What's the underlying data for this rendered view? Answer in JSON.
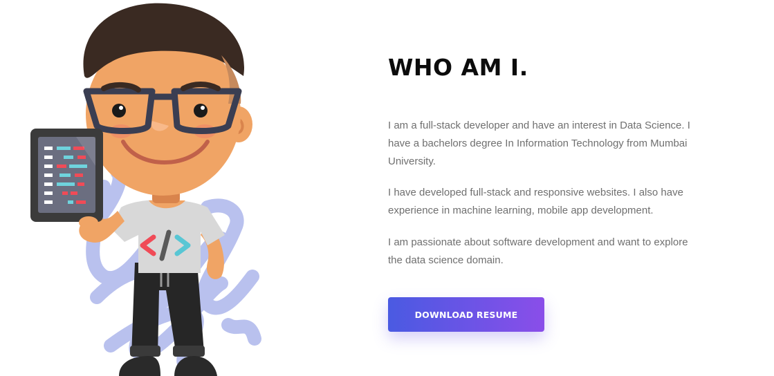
{
  "about": {
    "title": "WHO AM I.",
    "paragraphs": [
      "I am a full-stack developer and have an interest in Data Science. I have a bachelors degree In Information Technology from Mumbai University.",
      "I have developed full-stack and responsive websites. I also have experience in machine learning, mobile app development.",
      "I am passionate about software development and want to explore the data science domain."
    ],
    "download_button_label": "DOWNLOAD RESUME"
  },
  "illustration": {
    "subject": "developer-boy-holding-tablet",
    "shirt_icon": "</>"
  },
  "colors": {
    "accent_gradient_start": "#4a5ae2",
    "accent_gradient_end": "#8a4ee9",
    "title": "#0c0c0c",
    "body_text": "#6f6f6f",
    "scribble": "#b9c1ee"
  }
}
